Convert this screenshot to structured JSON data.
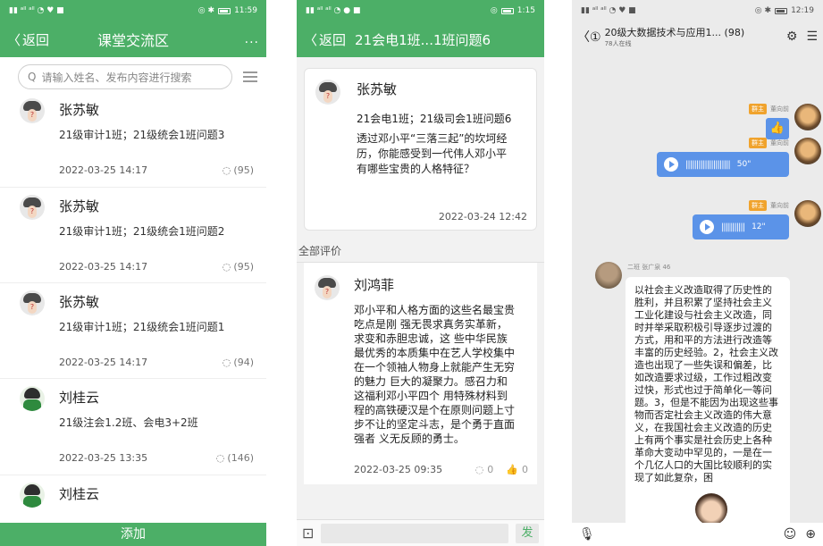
{
  "panel1": {
    "status_time": "11:59",
    "nav": {
      "back": "返回",
      "title": "课堂交流区",
      "more": "..."
    },
    "search_placeholder": "请输入姓名、发布内容进行搜索",
    "posts": [
      {
        "name": "张苏敏",
        "desc": "21级审计1班；21级统会1班问题3",
        "time": "2022-03-25 14:17",
        "count": "(95)"
      },
      {
        "name": "张苏敏",
        "desc": "21级审计1班；21级统会1班问题2",
        "time": "2022-03-25 14:17",
        "count": "(95)"
      },
      {
        "name": "张苏敏",
        "desc": "21级审计1班；21级统会1班问题1",
        "time": "2022-03-25 14:17",
        "count": "(94)"
      },
      {
        "name": "刘桂云",
        "desc": "21级注会1.2班、会电3+2班",
        "time": "2022-03-25 13:35",
        "count": "(146)"
      },
      {
        "name": "刘桂云"
      }
    ],
    "add_button": "添加"
  },
  "panel2": {
    "status_time": "1:15",
    "nav": {
      "back": "返回",
      "title": "21会电1班...1班问题6"
    },
    "card": {
      "name": "张苏敏",
      "line": "21会电1班；21级司会1班问题6",
      "body": "透过邓小平“三落三起”的坎坷经历，你能感受到一代伟人邓小平有哪些宝贵的人格特征？",
      "time": "2022-03-24 12:42"
    },
    "section_label": "全部评价",
    "comment": {
      "name": "刘鸿菲",
      "body": "邓小平和人格方面的这些名最宝贵吃点是刚 强无畏求真务实革新，求变和赤胆忠诚，这 些中华民族最优秀的本质集中在艺人学校集中在一个领袖人物身上就能产生无穷的魅力 巨大的凝聚力。感召力和这福利邓小平四个 用特殊材料到程的高铁硬汉是个在原则问题上寸步不让的坚定斗志，是个勇于直面强者 义无反顾的勇士。",
      "time": "2022-03-25 09:35",
      "comments": "0",
      "likes": "0"
    },
    "send": "发"
  },
  "panel3": {
    "status_time": "12:19",
    "title": "20级大数据技术与应用1... (98)",
    "online": "78人在线",
    "messages": [
      {
        "role": "群主",
        "name": "董向前",
        "type": "thumb"
      },
      {
        "role": "群主",
        "name": "董向前",
        "type": "voice",
        "duration": "50\""
      },
      {
        "role": "群主",
        "name": "董向前",
        "type": "voice",
        "duration": "12\""
      }
    ],
    "left_name": "二班 张广泉 46",
    "left_text": "以社会主义改造取得了历史性的胜利，并且积累了坚持社会主义工业化建设与社会主义改造，同时并举采取积极引导逐步过渡的方式，用和平的方法进行改造等丰富的历史经验。2，社会主义改造也出现了一些失误和偏差，比如改造要求过级，工作过粗改变过快，形式也过于简单化一等问题。3，但是不能因为出现这些事物而否定社会主义改造的伟大意义，在我国社会主义改造的历史上有两个事实是社会历史上各种革命大变动中罕见的，一是在一个几亿人口的大国比较顺利的实现了如此复杂，困"
  }
}
